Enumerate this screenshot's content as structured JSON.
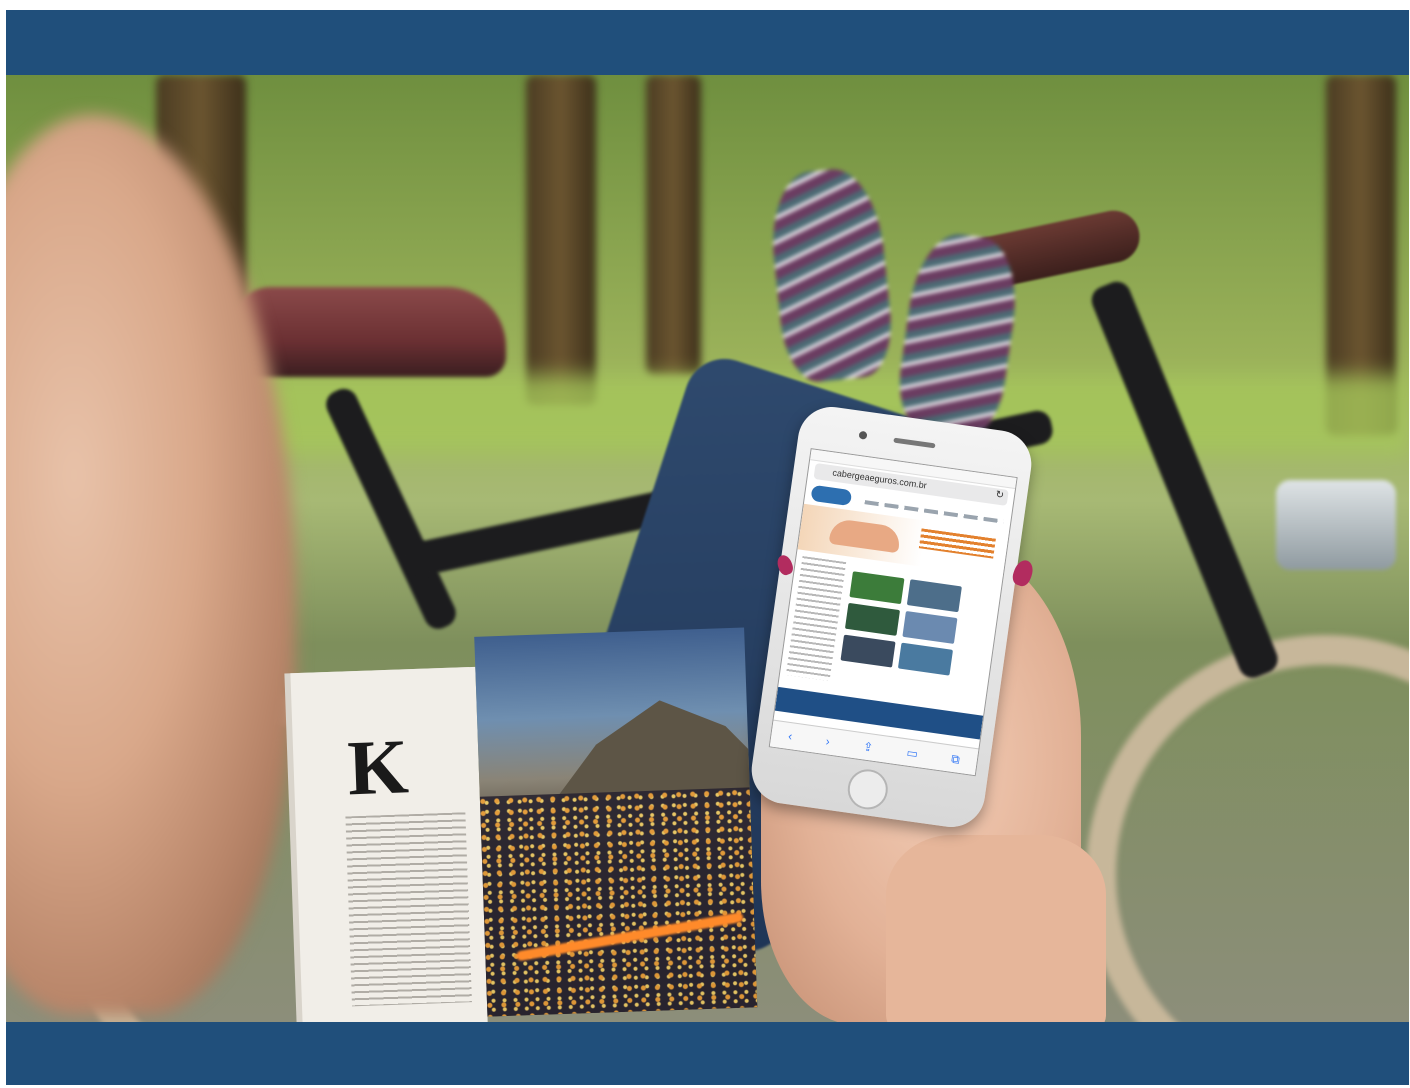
{
  "scene": {
    "band_color": "#204f7b",
    "description_icons": [
      "bicycle",
      "magazine",
      "smartphone",
      "hand",
      "sneakers"
    ]
  },
  "magazine": {
    "initial_letter": "K"
  },
  "phone": {
    "url": "cabergeaeguros.com.br",
    "reload_icon": "↻",
    "toolbar_icons": [
      "‹",
      "›",
      "⇪",
      "▭",
      "⧉"
    ]
  }
}
